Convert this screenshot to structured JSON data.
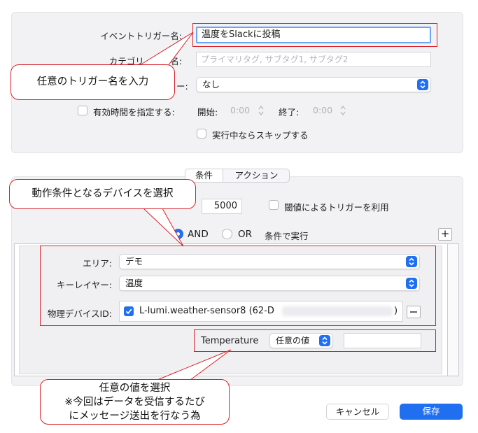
{
  "trigger": {
    "name_label": "イベントトリガー名:",
    "name_value": "温度をSlackに投稿",
    "category_label": "カテゴリ・タグ名:",
    "category_placeholder": "プライマリタグ, サブタグ1, サブタグ2",
    "popup_value": "なし",
    "validity_label": "有効時間を指定する:",
    "start_label": "開始:",
    "start_value": "0:00",
    "end_label": "終了:",
    "end_value": "0:00",
    "skip_label": "実行中ならスキップする"
  },
  "tabs": {
    "conditions": "条件",
    "actions": "アクション"
  },
  "condition": {
    "value": "5000",
    "threshold_label": "閾値によるトリガーを利用",
    "and_label": "AND",
    "or_label": "OR",
    "run_label": "条件で実行",
    "add_symbol": "+",
    "area_label": "エリア:",
    "area_value": "デモ",
    "keylayer_label": "キーレイヤー:",
    "keylayer_value": "温度",
    "device_label": "物理デバイスID:",
    "device_value": "L-lumi.weather-sensor8 (62-D",
    "device_suffix": ")",
    "temperature_label": "Temperature",
    "any_value": "任意の値"
  },
  "callouts": {
    "trigger_name": "任意のトリガー名を入力",
    "device": "動作条件となるデバイスを選択",
    "value_line1": "任意の値を選択",
    "value_line2": "※今回はデータを受信するたび",
    "value_line3": "にメッセージ送出を行なう為"
  },
  "buttons": {
    "cancel": "キャンセル",
    "save": "保存"
  },
  "colors": {
    "accent": "#1f6ff0",
    "callout_border": "#d8222a"
  }
}
